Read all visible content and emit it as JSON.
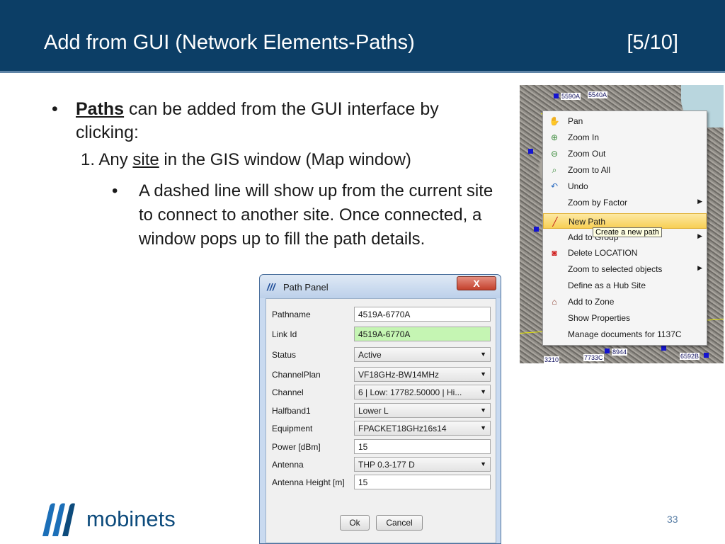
{
  "header": {
    "title": "Add from GUI (Network Elements-Paths)",
    "page_index": "[5/10]"
  },
  "bullets": {
    "b1_bold": "Paths",
    "b1_rest": "can be added from the GUI interface by clicking:",
    "b2_prefix": "1.  Any",
    "b2_link": "site",
    "b2_rest": "in the GIS window (Map window)",
    "b3": "A dashed line will show up from the current site to connect to another site. Once connected, a window pops up to fill the path details."
  },
  "map": {
    "labels": [
      "5590A",
      "5540A",
      "6770A",
      "8944",
      "7733C",
      "6592B",
      "3210",
      "1600"
    ]
  },
  "context_menu": {
    "items": [
      {
        "label": "Pan",
        "icon": "hand-icon"
      },
      {
        "label": "Zoom In",
        "icon": "zoom-in-icon"
      },
      {
        "label": "Zoom Out",
        "icon": "zoom-out-icon"
      },
      {
        "label": "Zoom to All",
        "icon": "zoom-all-icon"
      },
      {
        "label": "Undo",
        "icon": "undo-icon"
      },
      {
        "label": "Zoom by Factor",
        "submenu": true
      },
      {
        "label": "New Path",
        "icon": "new-path-icon",
        "selected": true
      },
      {
        "label": "Add to Group",
        "submenu": true
      },
      {
        "label": "Delete LOCATION",
        "icon": "delete-icon"
      },
      {
        "label": "Zoom to selected objects",
        "submenu": true
      },
      {
        "label": "Define as a Hub Site"
      },
      {
        "label": "Add to Zone",
        "icon": "home-icon"
      },
      {
        "label": "Show Properties"
      },
      {
        "label": "Manage documents for 1137C"
      }
    ],
    "tooltip": "Create a new path"
  },
  "dialog": {
    "title": "Path Panel",
    "close_label": "X",
    "fields": [
      {
        "label": "Pathname",
        "value": "4519A-6770A",
        "type": "text"
      },
      {
        "label": "Link Id",
        "value": "4519A-6770A",
        "type": "text-readonly"
      },
      {
        "label": "Status",
        "value": "Active",
        "type": "select"
      },
      {
        "label": "ChannelPlan",
        "value": "VF18GHz-BW14MHz",
        "type": "select"
      },
      {
        "label": "Channel",
        "value": "6 | Low: 17782.50000 | Hi...",
        "type": "select"
      },
      {
        "label": "Halfband1",
        "value": "Lower  L",
        "type": "select"
      },
      {
        "label": "Equipment",
        "value": "FPACKET18GHz16s14",
        "type": "select"
      },
      {
        "label": "Power [dBm]",
        "value": "15",
        "type": "text"
      },
      {
        "label": "Antenna",
        "value": "THP 0.3-177 D",
        "type": "select"
      },
      {
        "label": "Antenna Height [m]",
        "value": "15",
        "type": "text"
      }
    ],
    "ok_label": "Ok",
    "cancel_label": "Cancel"
  },
  "footer": {
    "logo_text": "mobinets",
    "page_number": "33"
  },
  "colors": {
    "header_bg": "#0c3e66",
    "accent": "#0d4b7c",
    "link_id_bg": "#c5f5b3",
    "menu_highlight": "#f7cf55"
  }
}
